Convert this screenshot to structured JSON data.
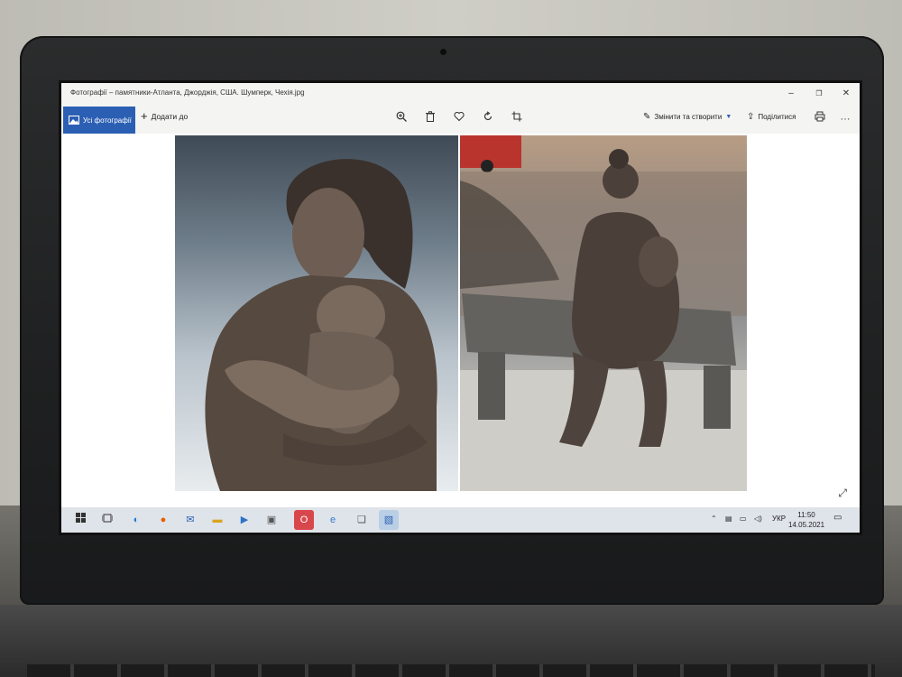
{
  "window": {
    "title": "Фотографії – памятники-Атланта, Джорджія, США.  Шумперк, Чехія.jpg",
    "minimize": "–",
    "maximize": "❐",
    "close": "✕"
  },
  "toolbar": {
    "all_photos_label": "Усі фотографії",
    "add_label": "Додати до",
    "edit_label": "Змінити та створити",
    "share_label": "Поділитися",
    "more_label": "···"
  },
  "images": {
    "left_alt": "Bronze bust of mother embracing baby",
    "right_alt": "Bronze statue of mother nursing child on bench"
  },
  "taskbar": {
    "language": "УКР",
    "time": "11:50",
    "date": "14.05.2021"
  },
  "icons": {
    "start": "windows-start-icon",
    "task_view": "task-view-icon",
    "edge": "edge-icon",
    "firefox": "firefox-icon",
    "mail": "mail-icon",
    "explorer": "file-explorer-icon",
    "media": "media-player-icon",
    "store": "store-icon",
    "opera": "opera-icon",
    "ie": "internet-explorer-icon",
    "files": "files-icon",
    "photos": "photos-icon"
  }
}
